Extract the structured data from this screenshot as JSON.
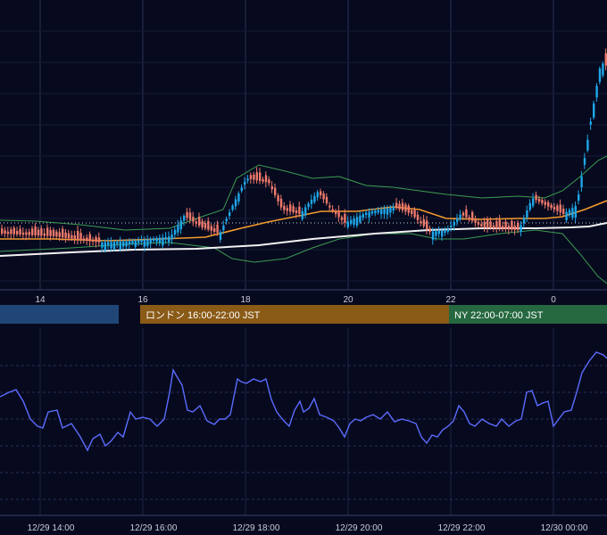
{
  "chart_data": [
    {
      "type": "candlestick",
      "panel": "price",
      "x_unit": "hour (JST)",
      "x_ticks": [
        "14",
        "16",
        "18",
        "20",
        "22",
        "0"
      ],
      "overlays": [
        "moving-average-orange",
        "moving-average-white",
        "bollinger-bands",
        "dotted-reference-line"
      ],
      "grid": true
    },
    {
      "type": "session-bars",
      "sessions": [
        {
          "label": "",
          "color": "#1f4677"
        },
        {
          "label": "ロンドン 16:00-22:00 JST",
          "color": "#8a5a17"
        },
        {
          "label": "NY 22:00-07:00 JST",
          "color": "#26683f"
        }
      ]
    },
    {
      "type": "line",
      "panel": "oscillator",
      "series_color": "#5b6cff",
      "x_ticks": [
        "12/29 14:00",
        "12/29 16:00",
        "12/29 18:00",
        "12/29 20:00",
        "12/29 22:00",
        "12/30 00:00"
      ],
      "grid": true
    }
  ],
  "colors": {
    "background": "#070a1f",
    "up_candle": "#1ea7e8",
    "down_candle": "#f07a6a",
    "ma_fast": "#f39a2b",
    "ma_slow": "#f2f2f2",
    "bollinger": "#3c9b50",
    "oscillator": "#5b6cff"
  }
}
